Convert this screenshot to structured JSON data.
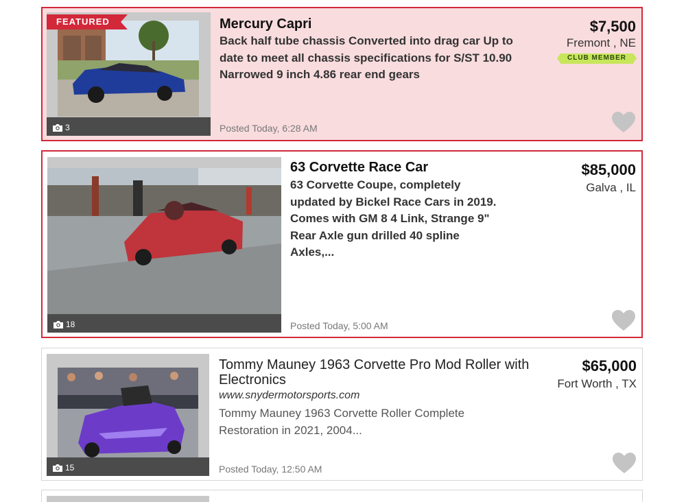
{
  "listings": [
    {
      "badge": "FEATURED",
      "title": "Mercury Capri",
      "description": "Back half tube chassis Converted into drag car Up to date to meet all chassis specifications for S/ST 10.90 Narrowed 9 inch 4.86 rear end gears",
      "posted": "Posted Today, 6:28 AM",
      "price": "$7,500",
      "location": "Fremont , NE",
      "club_label": "CLUB MEMBER",
      "photo_count": "3",
      "photo_icon": "camera-icon",
      "favorite_icon": "heart-icon"
    },
    {
      "title": "63 Corvette Race Car",
      "description": "63 Corvette Coupe, completely updated by Bickel Race Cars in 2019. Comes with GM 8 4 Link, Strange 9\" Rear Axle gun drilled 40 spline Axles,...",
      "posted": "Posted Today, 5:00 AM",
      "price": "$85,000",
      "location": "Galva , IL",
      "photo_count": "18",
      "photo_icon": "camera-icon",
      "favorite_icon": "heart-icon"
    },
    {
      "title": "Tommy Mauney 1963 Corvette Pro Mod Roller with Electronics",
      "website": "www.snydermotorsports.com",
      "description": "Tommy Mauney 1963 Corvette Roller Complete Restoration in 2021, 2004...",
      "posted": "Posted Today, 12:50 AM",
      "price": "$65,000",
      "location": "Fort Worth , TX",
      "photo_count": "15",
      "photo_icon": "camera-icon",
      "favorite_icon": "heart-icon"
    }
  ],
  "colors": {
    "featured_bg": "#f9dcde",
    "accent_red": "#d2283a",
    "club_green": "#c7e65a",
    "heart_gray": "#c4c4c4"
  }
}
